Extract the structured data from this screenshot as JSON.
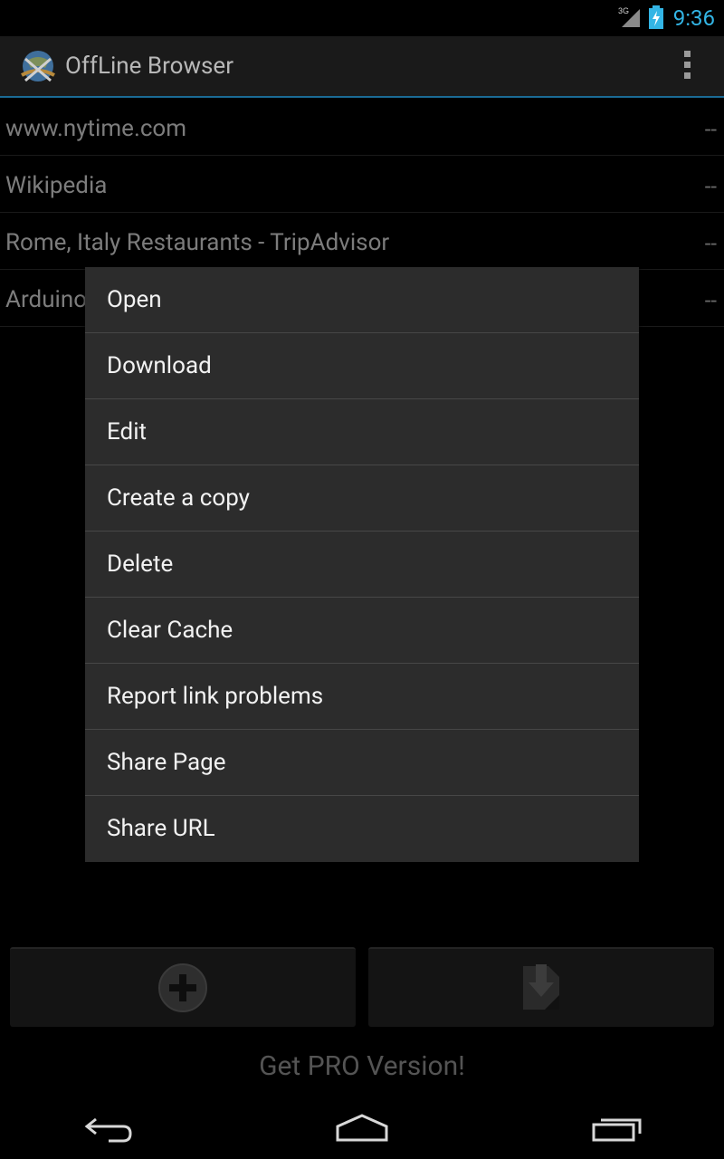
{
  "status_bar": {
    "network_label": "3G",
    "time": "9:36",
    "icons": [
      "signal-3g-icon",
      "battery-charging-icon"
    ]
  },
  "action_bar": {
    "title": "OffLine Browser",
    "logo_icon": "offline-browser-globe-icon",
    "overflow_icon": "overflow-menu-icon"
  },
  "list": {
    "items": [
      {
        "name": "www.nytime.com",
        "status": "--"
      },
      {
        "name": "Wikipedia",
        "status": "--"
      },
      {
        "name": "Rome, Italy Restaurants - TripAdvisor",
        "status": "--"
      },
      {
        "name": "Arduino",
        "status": "--"
      }
    ]
  },
  "context_menu": {
    "items": [
      "Open",
      "Download",
      "Edit",
      "Create a copy",
      "Delete",
      "Clear Cache",
      "Report link problems",
      "Share Page",
      "Share URL"
    ]
  },
  "bottom_buttons": {
    "add_icon": "add-circle-icon",
    "download_icon": "download-file-icon"
  },
  "promo": {
    "label": "Get PRO Version!"
  },
  "nav_bar": {
    "icons": [
      "back-icon",
      "home-icon",
      "recent-apps-icon"
    ]
  },
  "colors": {
    "accent": "#33b5e5",
    "action_bar_rule": "#1b6b96",
    "menu_background": "#2c2c2c"
  }
}
